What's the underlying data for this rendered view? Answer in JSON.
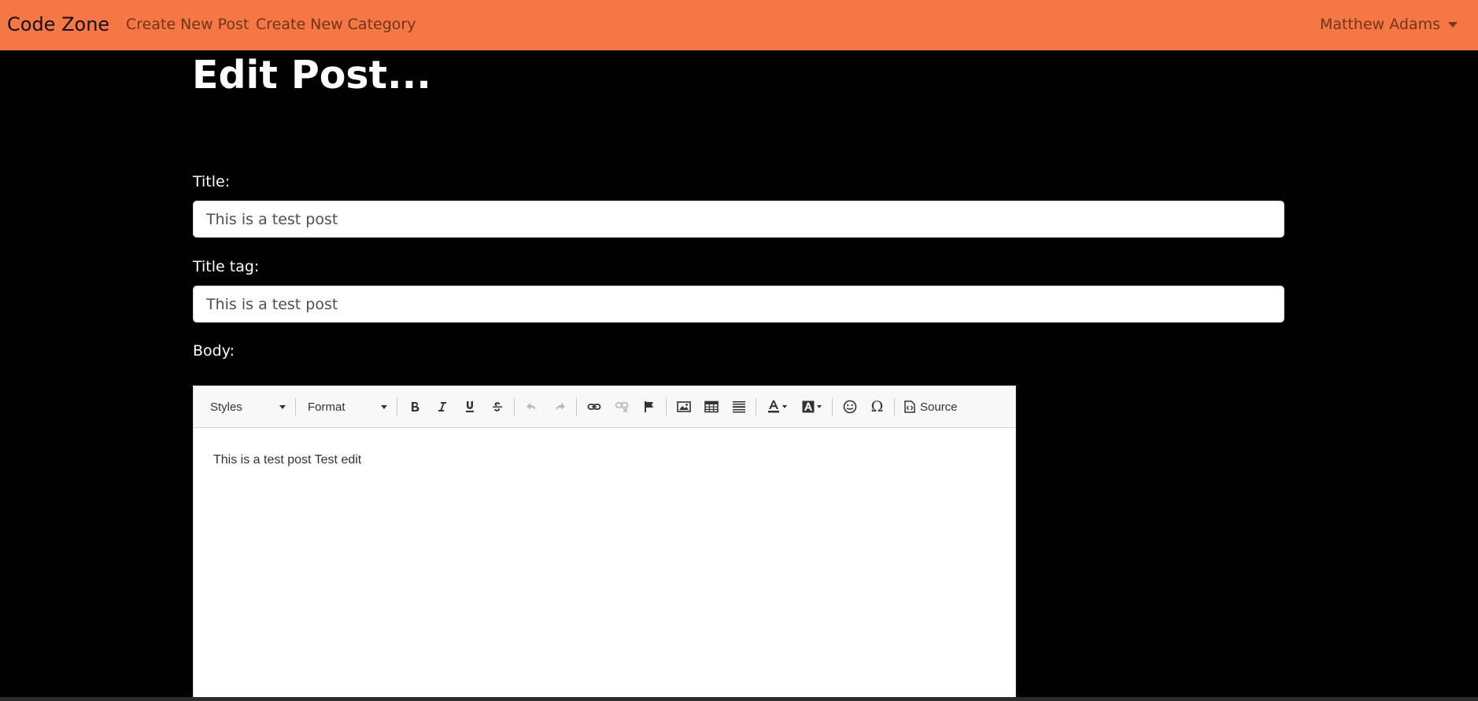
{
  "navbar": {
    "brand": "Code Zone",
    "links": [
      "Create New Post",
      "Create New Category"
    ],
    "user_name": "Matthew Adams",
    "background_color": "#f47744"
  },
  "page": {
    "title": "Edit Post..."
  },
  "form": {
    "title_label": "Title:",
    "title_value": "This is a test post",
    "title_tag_label": "Title tag:",
    "title_tag_value": "This is a test post",
    "body_label": "Body:"
  },
  "editor": {
    "styles_combo": "Styles",
    "format_combo": "Format",
    "toolbar_buttons": [
      "bold-icon",
      "italic-icon",
      "underline-icon",
      "strikethrough-icon",
      "undo-icon",
      "redo-icon",
      "link-icon",
      "unlink-icon",
      "anchor-flag-icon",
      "image-icon",
      "table-icon",
      "horizontal-line-icon",
      "text-color-icon",
      "background-color-icon",
      "emoji-icon",
      "special-character-icon",
      "source-icon"
    ],
    "source_label": "Source",
    "content": "This is a test post Test edit"
  }
}
